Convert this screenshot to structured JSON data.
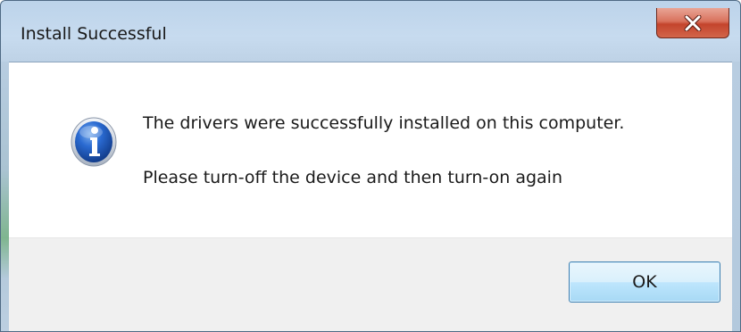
{
  "window": {
    "title": "Install Successful",
    "close_icon": "close-icon"
  },
  "message": {
    "icon": "info-icon",
    "line1": "The drivers were successfully installed on this computer.",
    "line2": "Please turn-off the device and then turn-on again"
  },
  "buttons": {
    "ok_label": "OK"
  },
  "colors": {
    "frame": "#bdd0e3",
    "close_button": "#c4442c",
    "info_icon_blue": "#1f5ab4",
    "button_bar": "#f0f0f0",
    "ok_border": "#3c7fb1"
  }
}
